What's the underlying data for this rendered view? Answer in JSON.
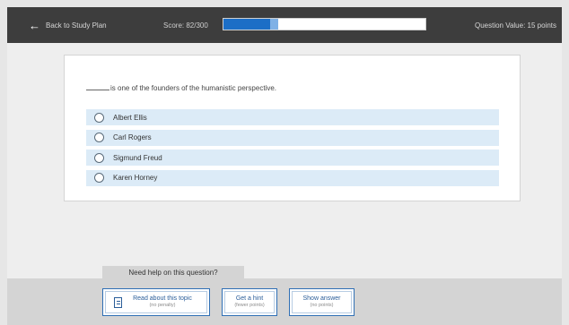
{
  "topbar": {
    "back_label": "Back to Study Plan",
    "score_label": "Score: 82/300",
    "score_fraction": 0.273,
    "question_value": "Question Value: 15 points"
  },
  "question": {
    "text": "is one of the founders of the humanistic perspective.",
    "options": [
      {
        "label": "Albert Ellis"
      },
      {
        "label": "Carl Rogers"
      },
      {
        "label": "Sigmund Freud"
      },
      {
        "label": "Karen Horney"
      }
    ]
  },
  "help": {
    "title": "Need help on this question?",
    "buttons": {
      "read": {
        "main": "Read about this topic",
        "sub": "(no penalty)"
      },
      "hint": {
        "main": "Get a hint",
        "sub": "(fewer points)"
      },
      "answer": {
        "main": "Show answer",
        "sub": "(no points)"
      }
    }
  },
  "colors": {
    "topbar": "#3d3d3d",
    "progress_fill": "#1c6ec6",
    "option_bg": "#dcebf7",
    "button_border": "#2f6fb5"
  },
  "icons": {
    "back": "arrow-left-icon",
    "radio": "radio-empty-icon",
    "read": "document-icon"
  }
}
